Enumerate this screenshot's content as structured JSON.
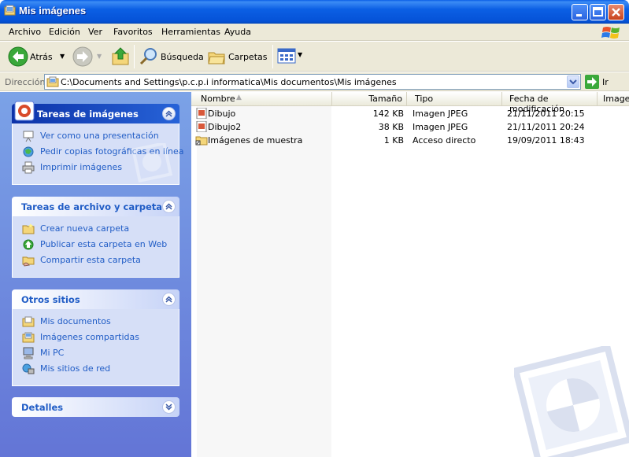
{
  "window": {
    "title": "Mis imágenes"
  },
  "menu": [
    "Archivo",
    "Edición",
    "Ver",
    "Favoritos",
    "Herramientas",
    "Ayuda"
  ],
  "toolbar": {
    "back": "Atrás",
    "search": "Búsqueda",
    "folders": "Carpetas"
  },
  "address": {
    "label": "Dirección",
    "path": "C:\\Documents and Settings\\p.c.p.i informatica\\Mis documentos\\Mis imágenes",
    "go": "Ir"
  },
  "panels": [
    {
      "title": "Tareas de imágenes",
      "items": [
        "Ver como una presentación",
        "Pedir copias fotográficas en línea",
        "Imprimir imágenes"
      ]
    },
    {
      "title": "Tareas de archivo y carpeta",
      "items": [
        "Crear nueva carpeta",
        "Publicar esta carpeta en Web",
        "Compartir esta carpeta"
      ]
    },
    {
      "title": "Otros sitios",
      "items": [
        "Mis documentos",
        "Imágenes compartidas",
        "Mi PC",
        "Mis sitios de red"
      ]
    },
    {
      "title": "Detalles",
      "items": []
    }
  ],
  "columns": [
    "Nombre",
    "Tamaño",
    "Tipo",
    "Fecha de modificación",
    "Image"
  ],
  "files": [
    {
      "name": "Dibujo",
      "size": "142 KB",
      "type": "Imagen JPEG",
      "date": "21/11/2011 20:15"
    },
    {
      "name": "Dibujo2",
      "size": "38 KB",
      "type": "Imagen JPEG",
      "date": "21/11/2011 20:24"
    },
    {
      "name": "Imágenes de muestra",
      "size": "1 KB",
      "type": "Acceso directo",
      "date": "19/09/2011 18:43"
    }
  ],
  "colors": {
    "title_blue": "#0552d7",
    "panel_bg": "#d6dff7",
    "link_blue": "#215dc6",
    "left_pane": "#6f8edf"
  }
}
